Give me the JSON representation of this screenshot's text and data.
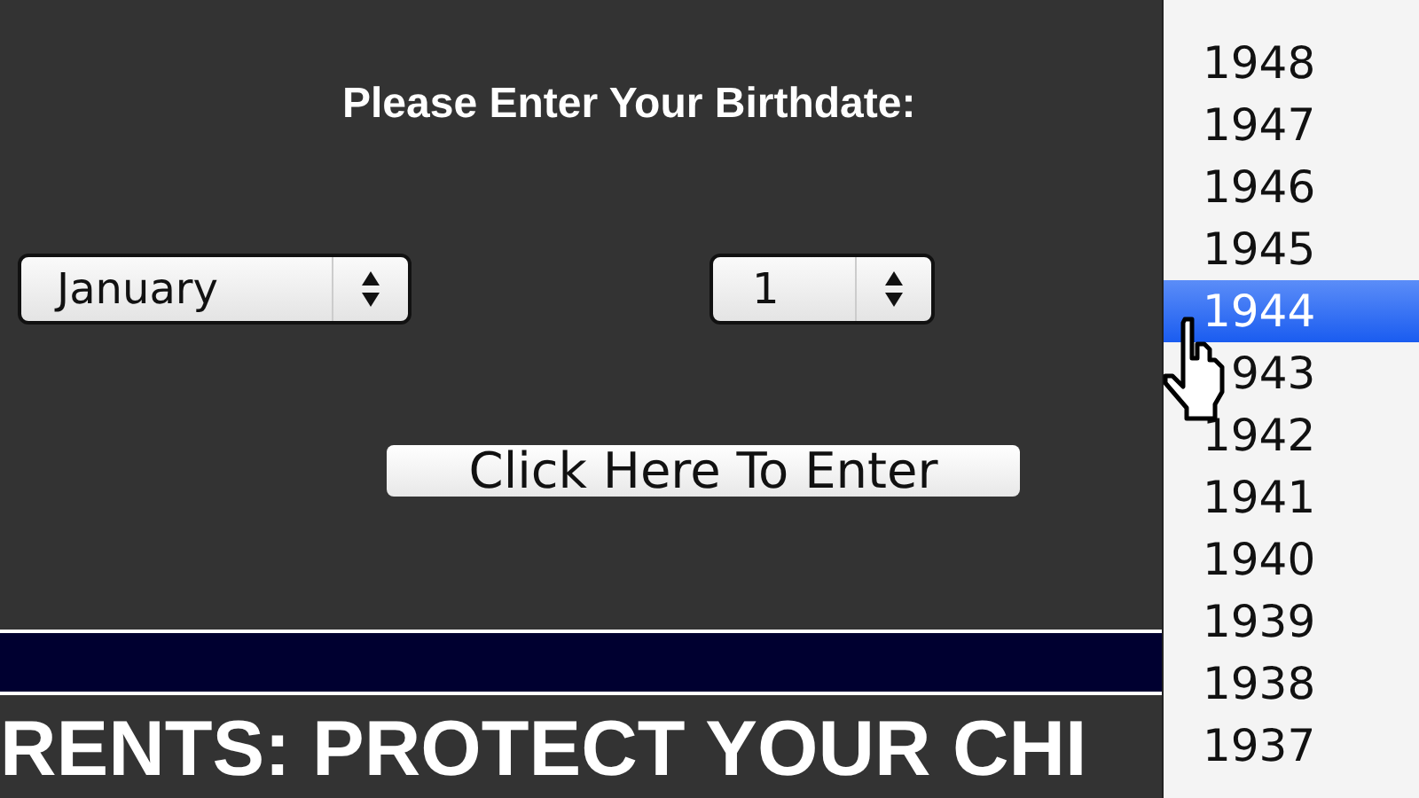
{
  "heading": "Please Enter Your Birthdate:",
  "month_select": {
    "value": "January"
  },
  "day_select": {
    "value": "1"
  },
  "enter_button": {
    "label": "Click Here To Enter"
  },
  "banner": {
    "text": "RENTS: PROTECT YOUR CHI"
  },
  "year_dropdown": {
    "items": [
      {
        "label": "1948",
        "selected": false
      },
      {
        "label": "1947",
        "selected": false
      },
      {
        "label": "1946",
        "selected": false
      },
      {
        "label": "1945",
        "selected": false
      },
      {
        "label": "1944",
        "selected": true
      },
      {
        "label": "943",
        "selected": false,
        "kind": "partly_hidden"
      },
      {
        "label": "1942",
        "selected": false
      },
      {
        "label": "1941",
        "selected": false
      },
      {
        "label": "1940",
        "selected": false
      },
      {
        "label": "1939",
        "selected": false
      },
      {
        "label": "1938",
        "selected": false
      },
      {
        "label": "1937",
        "selected": false
      }
    ]
  }
}
